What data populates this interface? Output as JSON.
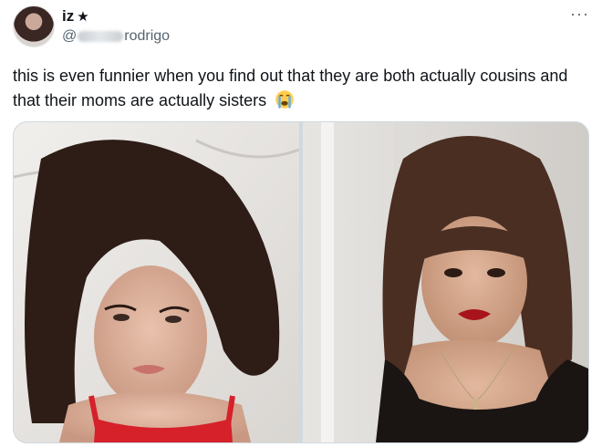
{
  "author": {
    "display_name": "iz",
    "badge": "★",
    "handle_prefix": "@",
    "handle_suffix": "rodrigo",
    "avatar_icon": "avatar-photo-icon"
  },
  "menu": {
    "more_label": "···"
  },
  "tweet": {
    "text": "this is even funnier when you find out that they are both actually cousins and that their moms are actually sisters",
    "emoji": "loudly-crying-face-emoji"
  },
  "media": {
    "photos": [
      {
        "name": "photo-left",
        "icon": "portrait-photo-icon"
      },
      {
        "name": "photo-right",
        "icon": "portrait-photo-icon"
      }
    ]
  },
  "colors": {
    "text": "#0f1419",
    "secondary_text": "#536471",
    "border": "#cfd9de",
    "top_red": "#d6202a",
    "lip_red": "#a8141c"
  }
}
